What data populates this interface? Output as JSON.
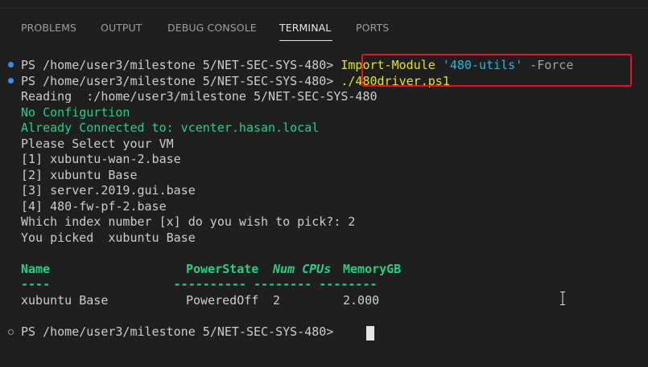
{
  "panel_tabs": {
    "problems": "PROBLEMS",
    "output": "OUTPUT",
    "debug_console": "DEBUG CONSOLE",
    "terminal": "TERMINAL",
    "ports": "PORTS",
    "active": "TERMINAL"
  },
  "terminal": {
    "prompt": "PS /home/user3/milestone 5/NET-SEC-SYS-480>",
    "cmd1": {
      "name": "Import-Module",
      "arg": "'480-utils'",
      "flag": "-Force"
    },
    "cmd2": "./480driver.ps1",
    "reading": "Reading  :/home/user3/milestone 5/NET-SEC-SYS-480",
    "no_config": "No Configurtion",
    "connected": "Already Connected to: vcenter.hasan.local",
    "select_vm": "Please Select your VM",
    "options": [
      "[1] xubuntu-wan-2.base",
      "[2] xubuntu Base",
      "[3] server.2019.gui.base",
      "[4] 480-fw-pf-2.base"
    ],
    "question": "Which index number [x] do you wish to pick?: 2",
    "picked": "You picked  xubuntu Base",
    "table": {
      "headers": [
        "Name",
        "PowerState",
        "Num CPUs",
        "MemoryGB"
      ],
      "underline": "----                 ---------- -------- --------",
      "row": [
        "xubuntu Base",
        "PoweredOff",
        "2",
        "2.000"
      ]
    }
  },
  "colors": {
    "background": "#1f1f1f",
    "green": "#23d18b",
    "yellow": "#e5e510",
    "cyan": "#29b8db",
    "highlight": "#e81123",
    "prompt_dot": "#3b8eea"
  }
}
